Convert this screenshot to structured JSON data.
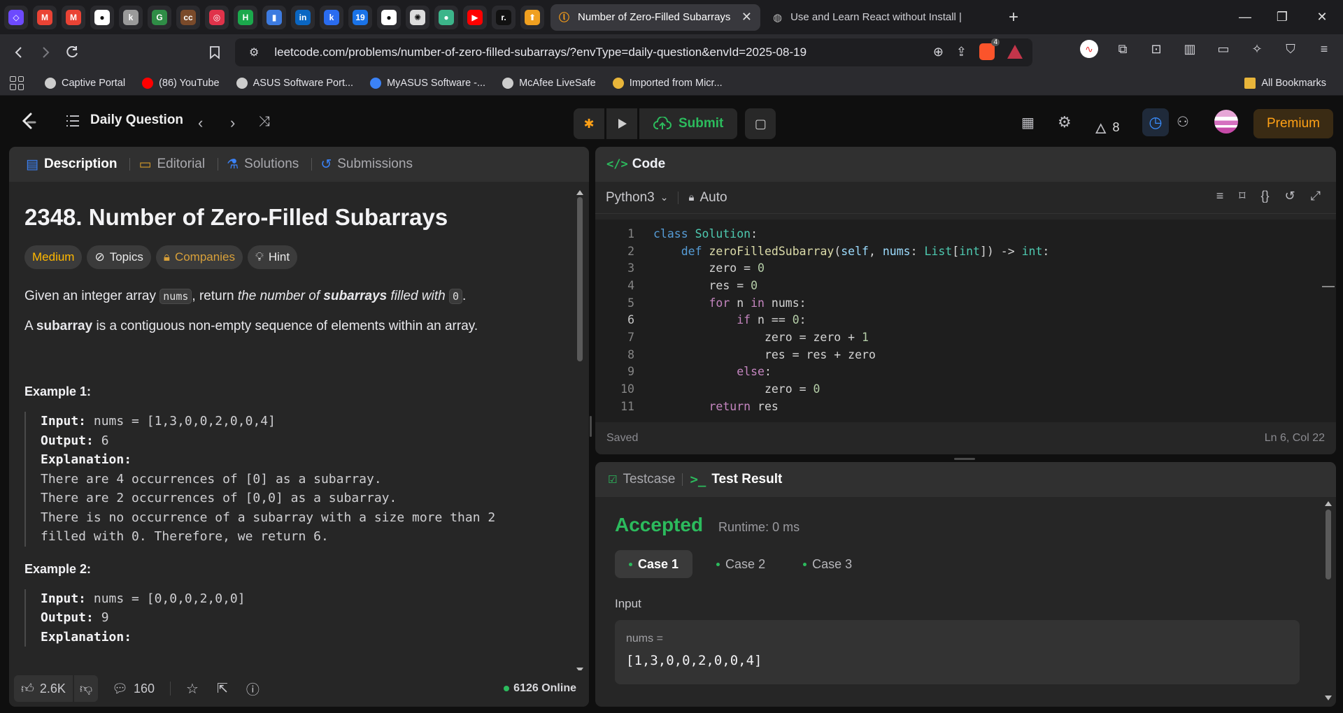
{
  "browser": {
    "pinned_tabs": [
      {
        "name": "proton-tab",
        "glyph": "◇",
        "color": "#6d4aff"
      },
      {
        "name": "gmail-tab-1",
        "glyph": "M",
        "color": "#ea4335"
      },
      {
        "name": "gmail-tab-2",
        "glyph": "M",
        "color": "#ea4335"
      },
      {
        "name": "github-tab-1",
        "glyph": "●",
        "color": "#ffffff"
      },
      {
        "name": "k-tab",
        "glyph": "k",
        "color": "#9a9a9a"
      },
      {
        "name": "gfg-tab",
        "glyph": "G",
        "color": "#2f8d46"
      },
      {
        "name": "cc-tab",
        "glyph": "cc",
        "color": "#7a4a2a"
      },
      {
        "name": "target-tab",
        "glyph": "◎",
        "color": "#e0334a"
      },
      {
        "name": "hackerrank-tab",
        "glyph": "H",
        "color": "#1ba94c"
      },
      {
        "name": "chart-tab",
        "glyph": "▮",
        "color": "#3d7be0"
      },
      {
        "name": "linkedin-tab",
        "glyph": "in",
        "color": "#0a66c2"
      },
      {
        "name": "k-blue-tab",
        "glyph": "k",
        "color": "#2a6cf0"
      },
      {
        "name": "calendar-tab",
        "glyph": "19",
        "color": "#1a73e8"
      },
      {
        "name": "github-tab-2",
        "glyph": "●",
        "color": "#ffffff"
      },
      {
        "name": "openai-tab",
        "glyph": "✺",
        "color": "#dddddd"
      },
      {
        "name": "green-tab",
        "glyph": "●",
        "color": "#3cb58a"
      },
      {
        "name": "youtube-tab",
        "glyph": "▶",
        "color": "#ff0000"
      },
      {
        "name": "r-tab",
        "glyph": "r.",
        "color": "#111111"
      },
      {
        "name": "rocket-tab",
        "glyph": "⬆",
        "color": "#f0a020"
      }
    ],
    "active_tab_title": "Number of Zero-Filled Subarrays",
    "inactive_tab_title": "Use and Learn React without Install |",
    "url": "leetcode.com/problems/number-of-zero-filled-subarrays/?envType=daily-question&envId=2025-08-19",
    "brave_badge": "4",
    "bookmarks": [
      {
        "label": "Captive Portal",
        "color": "#cccccc"
      },
      {
        "label": "(86) YouTube",
        "color": "#ff0000"
      },
      {
        "label": "ASUS Software Port...",
        "color": "#cccccc"
      },
      {
        "label": "MyASUS Software -...",
        "color": "#3b82f6"
      },
      {
        "label": "McAfee LiveSafe",
        "color": "#cccccc"
      },
      {
        "label": "Imported from Micr...",
        "color": "#e8b53a"
      }
    ],
    "all_bookmarks": "All Bookmarks"
  },
  "lc_nav": {
    "daily_question": "Daily Question",
    "submit": "Submit",
    "streak": "8",
    "premium": "Premium"
  },
  "left_tabs": [
    "Description",
    "Editorial",
    "Solutions",
    "Submissions"
  ],
  "problem": {
    "title": "2348. Number of Zero-Filled Subarrays",
    "tags": [
      "Medium",
      "Topics",
      "Companies",
      "Hint"
    ],
    "intro_pre": "Given an integer array ",
    "intro_code1": "nums",
    "intro_mid": ", return ",
    "intro_em1": "the number of ",
    "intro_strong": "subarrays",
    "intro_em2": " filled with ",
    "intro_code2": "0",
    "intro_end": ".",
    "subarray_pre": "A ",
    "subarray_strong": "subarray",
    "subarray_post": " is a contiguous non-empty sequence of elements within an array.",
    "example1_title": "Example 1:",
    "example1": {
      "input_label": "Input:",
      "input": " nums = [1,3,0,0,2,0,0,4]",
      "output_label": "Output:",
      "output": " 6",
      "explanation_label": "Explanation:",
      "lines": [
        "There are 4 occurrences of [0] as a subarray.",
        "There are 2 occurrences of [0,0] as a subarray.",
        "There is no occurrence of a subarray with a size more than 2",
        "filled with 0. Therefore, we return 6."
      ]
    },
    "example2_title": "Example 2:",
    "example2": {
      "input_label": "Input:",
      "input": " nums = [0,0,0,2,0,0]",
      "output_label": "Output:",
      "output": " 9",
      "explanation_label": "Explanation:"
    }
  },
  "left_footer": {
    "likes": "2.6K",
    "comments": "160",
    "online": "6126 Online"
  },
  "code_panel": {
    "title": "Code",
    "language": "Python3",
    "mode": "Auto",
    "saved": "Saved",
    "cursor": "Ln 6, Col 22",
    "current_line": 6
  },
  "result_panel": {
    "testcase_tab": "Testcase",
    "result_tab": "Test Result",
    "status": "Accepted",
    "runtime": "Runtime: 0 ms",
    "cases": [
      "Case 1",
      "Case 2",
      "Case 3"
    ],
    "input_label": "Input",
    "input_name": "nums =",
    "input_value": "[1,3,0,0,2,0,0,4]"
  },
  "colors": {
    "accent_green": "#2cbb5d",
    "premium_orange": "#ffa116",
    "medium_yellow": "#ffb800"
  }
}
